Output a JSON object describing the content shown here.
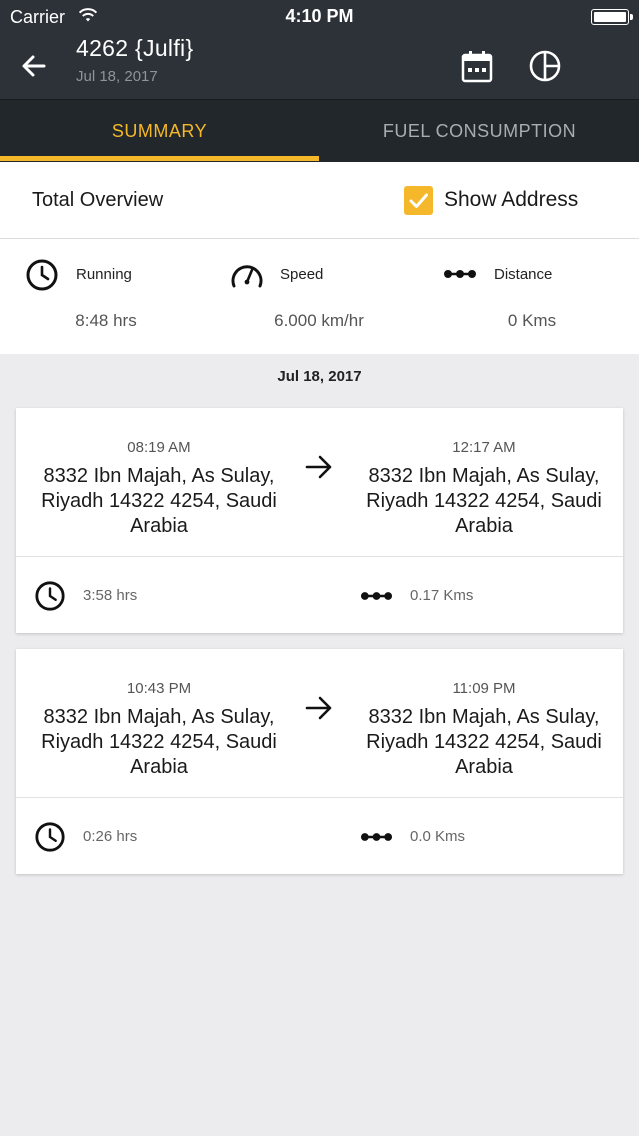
{
  "status_bar": {
    "carrier": "Carrier",
    "time": "4:10 PM"
  },
  "header": {
    "title": "4262 {Julfi}",
    "subtitle": "Jul 18, 2017"
  },
  "tabs": [
    {
      "label": "SUMMARY",
      "active": true
    },
    {
      "label": "FUEL CONSUMPTION",
      "active": false
    }
  ],
  "overview": {
    "title": "Total Overview",
    "show_address_label": "Show Address",
    "show_address_checked": true
  },
  "stats": {
    "running": {
      "label": "Running",
      "value": "8:48 hrs"
    },
    "speed": {
      "label": "Speed",
      "value": "6.000 km/hr"
    },
    "distance": {
      "label": "Distance",
      "value": "0 Kms"
    }
  },
  "date_heading": "Jul 18, 2017",
  "trips": [
    {
      "start_time": "08:19 AM",
      "start_address": "8332 Ibn Majah, As Sulay, Riyadh 14322 4254, Saudi Arabia",
      "end_time": "12:17 AM",
      "end_address": "8332 Ibn Majah, As Sulay, Riyadh 14322 4254, Saudi Arabia",
      "duration": "3:58 hrs",
      "distance": "0.17 Kms"
    },
    {
      "start_time": "10:43 PM",
      "start_address": "8332 Ibn Majah, As Sulay, Riyadh 14322 4254, Saudi Arabia",
      "end_time": "11:09 PM",
      "end_address": "8332 Ibn Majah, As Sulay, Riyadh 14322 4254, Saudi Arabia",
      "duration": "0:26 hrs",
      "distance": "0.0 Kms"
    }
  ],
  "colors": {
    "accent": "#f5b82a",
    "header_bg": "#2c3238",
    "tab_bg": "#22272b"
  },
  "icons": [
    "back-arrow-icon",
    "calendar-icon",
    "pie-chart-icon",
    "clock-icon",
    "speedometer-icon",
    "distance-dots-icon",
    "right-arrow-icon",
    "checkmark-icon",
    "wifi-icon",
    "battery-icon"
  ]
}
